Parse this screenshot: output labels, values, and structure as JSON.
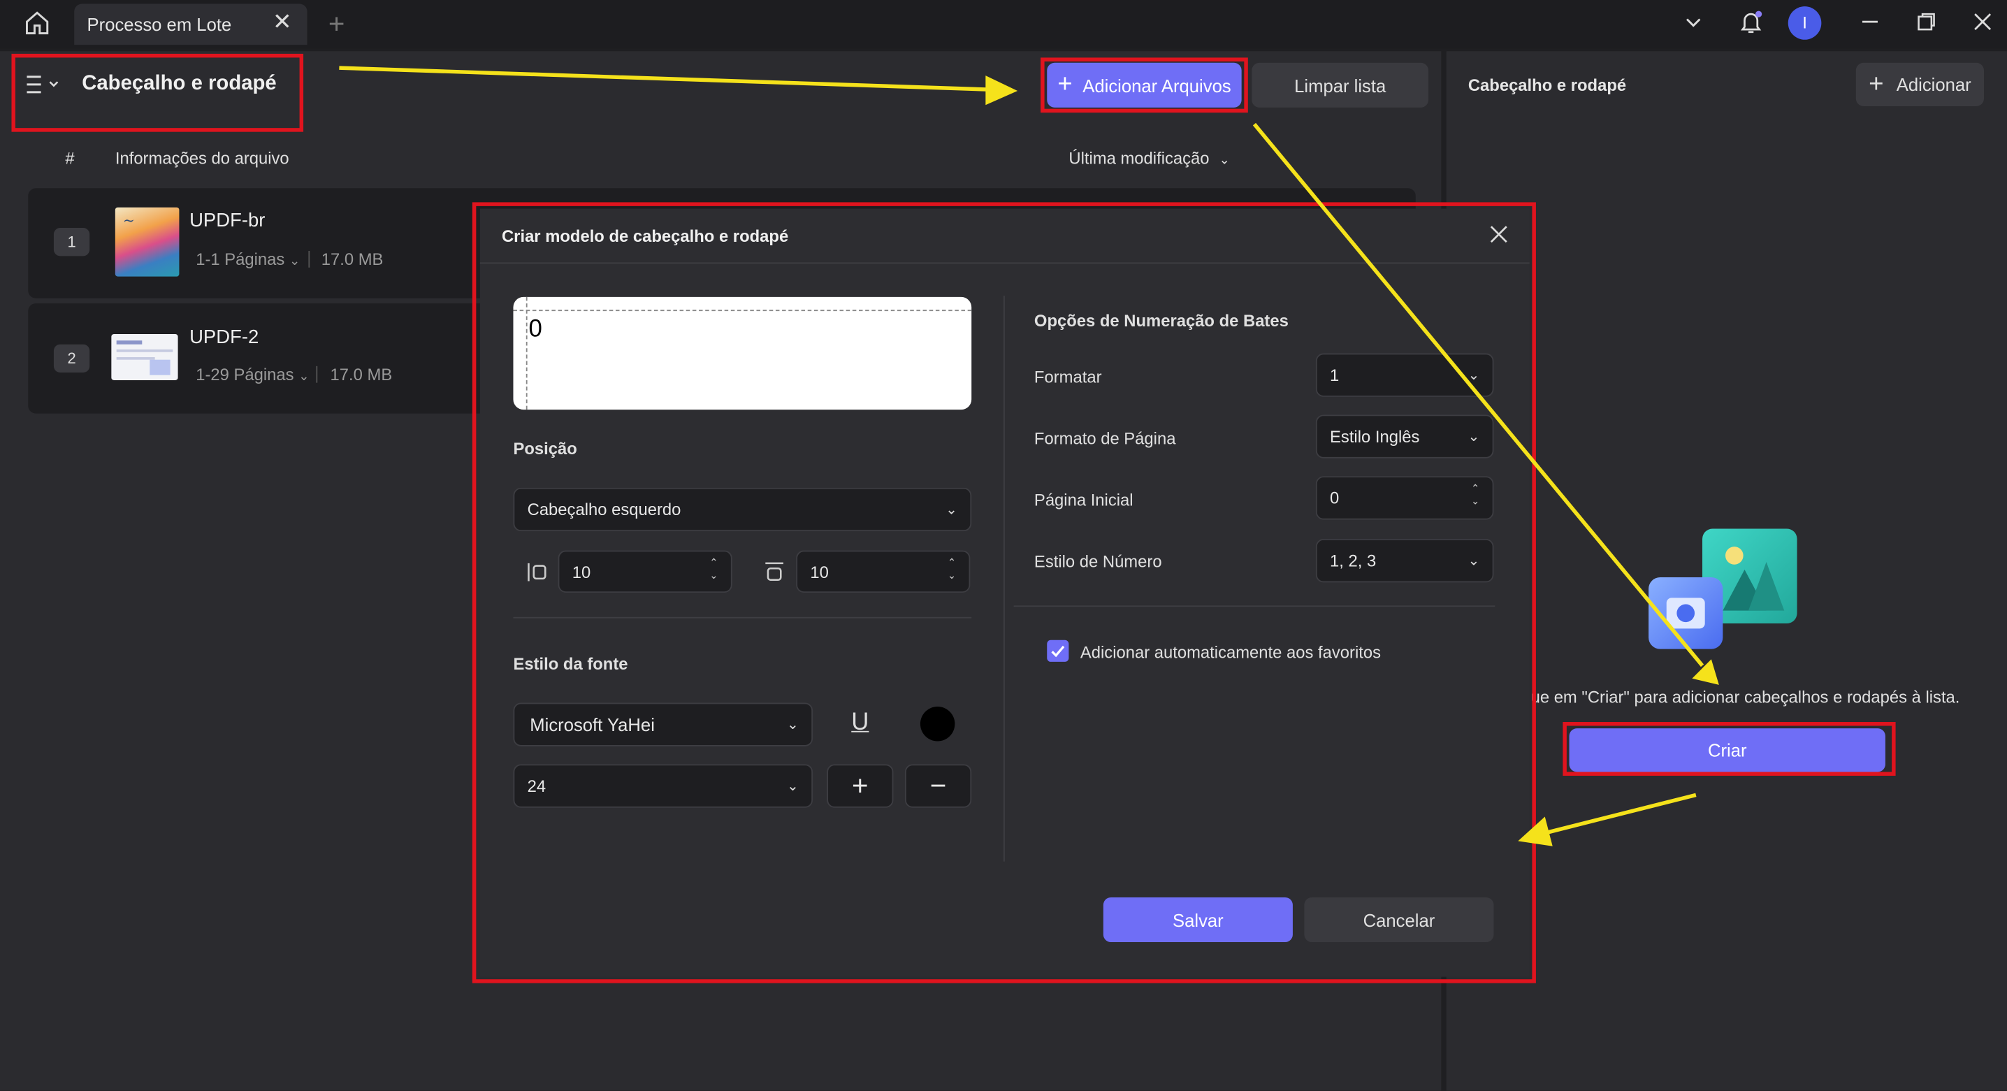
{
  "titlebar": {
    "tab_label": "Processo em Lote",
    "tab_close": "✕",
    "new_tab": "+",
    "user_initial": "I"
  },
  "toolbar": {
    "title": "Cabeçalho e rodapé",
    "add_files_label": "Adicionar Arquivos",
    "clear_list_label": "Limpar lista"
  },
  "table": {
    "col_index": "#",
    "col_info": "Informações do arquivo",
    "col_modified": "Última modificação"
  },
  "files": [
    {
      "index": "1",
      "name": "UPDF-br",
      "pages": "1-1 Páginas",
      "size": "17.0 MB"
    },
    {
      "index": "2",
      "name": "UPDF-2",
      "pages": "1-29 Páginas",
      "size": "17.0 MB"
    }
  ],
  "right_panel": {
    "title": "Cabeçalho e rodapé",
    "add_label": "Adicionar",
    "hint": "ue em \"Criar\" para adicionar cabeçalhos e rodapés à lista.",
    "create_label": "Criar"
  },
  "dialog": {
    "title": "Criar modelo de cabeçalho e rodapé",
    "preview_text": "0",
    "position_heading": "Posição",
    "position_value": "Cabeçalho esquerdo",
    "margin_left": "10",
    "margin_top": "10",
    "font_heading": "Estilo da fonte",
    "font_family": "Microsoft YaHei",
    "font_size": "24",
    "underline_glyph": "U",
    "font_color": "#000000",
    "bates_heading": "Opções de Numeração de Bates",
    "format_label": "Formatar",
    "format_value": "1",
    "page_format_label": "Formato de Página",
    "page_format_value": "Estilo Inglês",
    "start_page_label": "Página Inicial",
    "start_page_value": "0",
    "number_style_label": "Estilo de Número",
    "number_style_value": "1, 2, 3",
    "auto_fav_label": "Adicionar automaticamente aos favoritos",
    "auto_fav_checked": true,
    "save_label": "Salvar",
    "cancel_label": "Cancelar"
  },
  "colors": {
    "accent": "#6f6ef6",
    "annotation_red": "#e0141e",
    "annotation_yellow": "#f5e21b"
  }
}
